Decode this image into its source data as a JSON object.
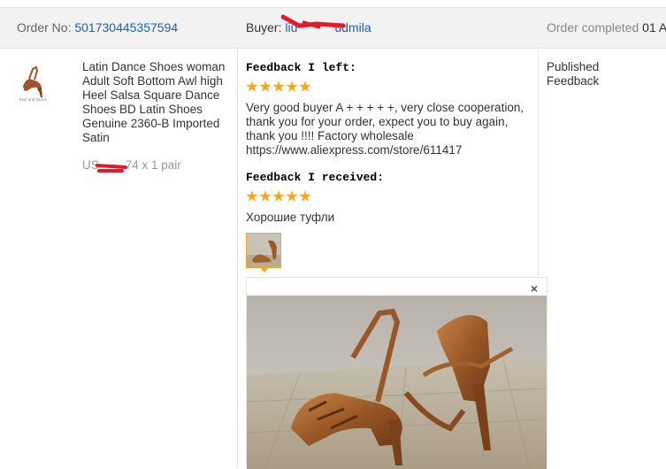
{
  "order": {
    "label": "Order No:",
    "number": "501730445357594",
    "buyer_label": "Buyer:",
    "buyer_name_start": "liu",
    "buyer_name_end": "udmila",
    "status_label": "Order completed",
    "status_date": "01 A"
  },
  "product": {
    "thumb_caption": "heel and dance",
    "title": "Latin Dance Shoes woman Adult Soft Bottom Awl high Heel Salsa Square Dance Shoes BD Latin Shoes Genuine 2360-B Imported Satin",
    "price_prefix": "US",
    "price_suffix": "74 x 1 pair"
  },
  "feedback_left": {
    "heading": "Feedback I left:",
    "stars": 5,
    "text": "Very good buyer A + + + + +, very close cooperation, thank you for your order, expect you to buy again, thank you !!!! Factory wholesale https://www.aliexpress.com/store/611417"
  },
  "feedback_received": {
    "heading": "Feedback I received:",
    "stars": 5,
    "text": "Хорошие туфли"
  },
  "preview": {
    "close_label": "×"
  },
  "status_col": {
    "line1": "Published",
    "line2": "Feedback"
  },
  "colors": {
    "link": "#1a62b8",
    "star": "#f5a623",
    "redaction": "#e8182a"
  }
}
